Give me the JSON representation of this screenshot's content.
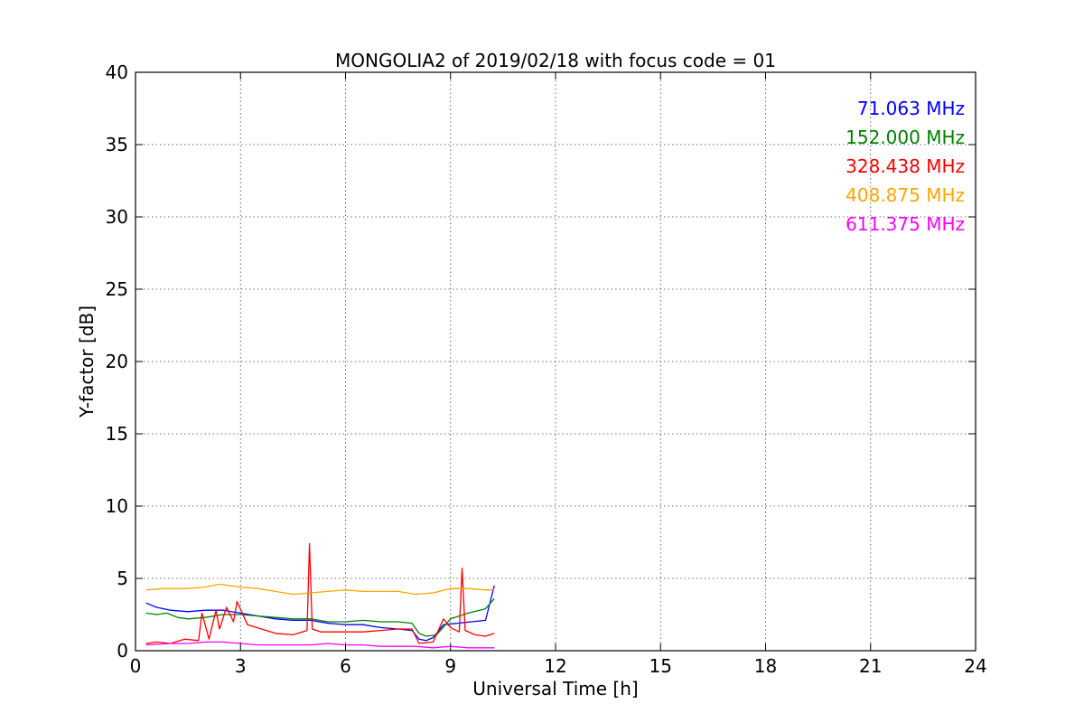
{
  "chart_data": {
    "type": "line",
    "title": "MONGOLIA2 of 2019/02/18 with focus code = 01",
    "xlabel": "Universal Time [h]",
    "ylabel": "Y-factor [dB]",
    "xlim": [
      0,
      24
    ],
    "ylim": [
      0,
      40
    ],
    "xticks": [
      0,
      3,
      6,
      9,
      12,
      15,
      18,
      21,
      24
    ],
    "yticks": [
      0,
      5,
      10,
      15,
      20,
      25,
      30,
      35,
      40
    ],
    "grid": true,
    "legend_position": "top-right",
    "series": [
      {
        "name": "71.063 MHz",
        "color": "#0000ff",
        "x": [
          0.3,
          0.6,
          1.0,
          1.5,
          2.0,
          2.5,
          3.0,
          3.5,
          4.0,
          4.5,
          5.0,
          5.5,
          6.0,
          6.5,
          7.0,
          7.5,
          7.9,
          8.1,
          8.3,
          8.5,
          8.8,
          9.2,
          9.6,
          10.0,
          10.25
        ],
        "y": [
          3.3,
          3.0,
          2.8,
          2.7,
          2.8,
          2.8,
          2.6,
          2.4,
          2.2,
          2.1,
          2.1,
          1.9,
          1.8,
          1.8,
          1.6,
          1.5,
          1.4,
          0.8,
          0.7,
          0.9,
          1.8,
          1.9,
          2.0,
          2.1,
          4.5
        ]
      },
      {
        "name": "152.000 MHz",
        "color": "#008000",
        "x": [
          0.3,
          0.6,
          0.9,
          1.2,
          1.5,
          2.0,
          2.5,
          3.0,
          3.5,
          4.0,
          4.5,
          5.0,
          5.5,
          6.0,
          6.5,
          7.0,
          7.5,
          7.9,
          8.1,
          8.3,
          8.6,
          9.0,
          9.5,
          10.0,
          10.25
        ],
        "y": [
          2.6,
          2.5,
          2.6,
          2.3,
          2.2,
          2.3,
          2.5,
          2.5,
          2.4,
          2.3,
          2.2,
          2.2,
          2.0,
          2.0,
          2.1,
          2.0,
          2.0,
          1.9,
          1.2,
          1.0,
          1.1,
          2.2,
          2.6,
          2.9,
          3.6
        ]
      },
      {
        "name": "328.438 MHz",
        "color": "#ff0000",
        "x": [
          0.3,
          0.6,
          1.0,
          1.4,
          1.8,
          1.9,
          2.1,
          2.3,
          2.4,
          2.6,
          2.8,
          2.9,
          3.2,
          3.6,
          4.0,
          4.5,
          4.9,
          4.97,
          5.05,
          5.3,
          6.0,
          6.5,
          7.0,
          7.5,
          7.9,
          8.1,
          8.5,
          8.8,
          9.0,
          9.25,
          9.33,
          9.42,
          9.7,
          10.0,
          10.25
        ],
        "y": [
          0.5,
          0.6,
          0.5,
          0.8,
          0.7,
          2.6,
          0.8,
          2.8,
          1.5,
          3.0,
          2.0,
          3.4,
          1.8,
          1.5,
          1.2,
          1.1,
          1.4,
          7.4,
          1.5,
          1.3,
          1.3,
          1.3,
          1.4,
          1.5,
          1.5,
          0.5,
          0.6,
          2.2,
          1.6,
          1.3,
          5.7,
          1.4,
          1.1,
          1.0,
          1.2
        ]
      },
      {
        "name": "408.875 MHz",
        "color": "#ffa500",
        "x": [
          0.3,
          0.8,
          1.5,
          2.0,
          2.4,
          3.0,
          3.5,
          4.0,
          4.5,
          5.0,
          5.5,
          6.0,
          6.5,
          7.0,
          7.5,
          8.0,
          8.5,
          9.0,
          9.5,
          10.0,
          10.25
        ],
        "y": [
          4.2,
          4.3,
          4.3,
          4.4,
          4.6,
          4.4,
          4.3,
          4.1,
          3.9,
          4.0,
          4.1,
          4.2,
          4.1,
          4.1,
          4.1,
          3.9,
          4.0,
          4.3,
          4.3,
          4.2,
          4.2
        ]
      },
      {
        "name": "611.375 MHz",
        "color": "#ff00ff",
        "x": [
          0.3,
          1.0,
          1.5,
          2.0,
          2.5,
          3.0,
          3.5,
          4.0,
          4.5,
          5.0,
          5.5,
          6.0,
          6.5,
          7.0,
          7.5,
          8.0,
          8.5,
          9.0,
          9.5,
          10.0,
          10.25
        ],
        "y": [
          0.4,
          0.5,
          0.5,
          0.6,
          0.6,
          0.5,
          0.4,
          0.4,
          0.4,
          0.4,
          0.5,
          0.4,
          0.4,
          0.3,
          0.3,
          0.3,
          0.2,
          0.3,
          0.2,
          0.2,
          0.2
        ]
      }
    ]
  }
}
